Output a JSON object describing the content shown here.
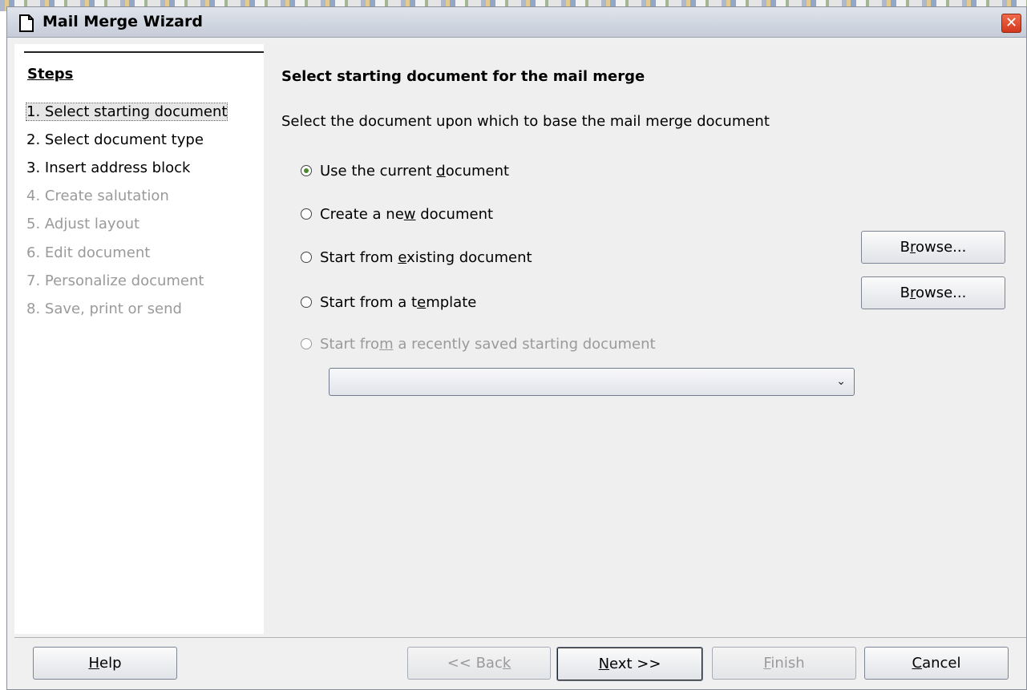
{
  "window": {
    "title": "Mail Merge Wizard",
    "close_glyph": "✕"
  },
  "steps": {
    "heading": "Steps",
    "items": [
      {
        "label": "1. Select starting document",
        "state": "active"
      },
      {
        "label": "2. Select document type",
        "state": "enabled"
      },
      {
        "label": "3. Insert address block",
        "state": "enabled"
      },
      {
        "label": "4. Create salutation",
        "state": "disabled"
      },
      {
        "label": "5. Adjust layout",
        "state": "disabled"
      },
      {
        "label": "6. Edit document",
        "state": "disabled"
      },
      {
        "label": "7. Personalize document",
        "state": "disabled"
      },
      {
        "label": "8. Save, print or send",
        "state": "disabled"
      }
    ]
  },
  "main": {
    "heading": "Select starting document for the mail merge",
    "description": "Select the document upon which to base the mail merge document",
    "options": [
      {
        "pre": "Use the current ",
        "acc": "d",
        "post": "ocument",
        "checked": true,
        "enabled": true
      },
      {
        "pre": "Create a ne",
        "acc": "w",
        "post": " document",
        "checked": false,
        "enabled": true
      },
      {
        "pre": "Start from ",
        "acc": "e",
        "post": "xisting document",
        "checked": false,
        "enabled": true
      },
      {
        "pre": "Start from a t",
        "acc": "e",
        "post": "mplate",
        "checked": false,
        "enabled": true
      },
      {
        "pre": "Start fro",
        "acc": "m",
        "post": " a recently saved starting document",
        "checked": false,
        "enabled": false
      }
    ],
    "browse_existing": {
      "pre": "B",
      "acc": "r",
      "post": "owse..."
    },
    "browse_template": {
      "pre": "B",
      "acc": "r",
      "post": "owse..."
    },
    "recent_combo_value": "",
    "combo_arrow_glyph": "⌄"
  },
  "footer": {
    "help": {
      "pre": "",
      "acc": "H",
      "post": "elp"
    },
    "back": {
      "pre": "<< Bac",
      "acc": "k",
      "post": ""
    },
    "next": {
      "pre": "",
      "acc": "N",
      "post": "ext >>"
    },
    "finish": {
      "pre": "",
      "acc": "F",
      "post": "inish"
    },
    "cancel": {
      "pre": "",
      "acc": "C",
      "post": "ancel"
    }
  },
  "colors": {
    "accent_radio": "#4a8a2a",
    "disabled_text": "#9a9a9a",
    "close_button": "#d3381c"
  }
}
